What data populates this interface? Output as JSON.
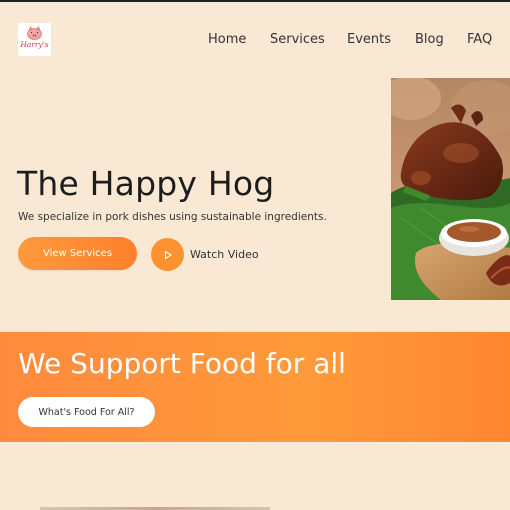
{
  "brand": {
    "logo_text": "Harry's",
    "logo_icon": "pig-icon"
  },
  "nav": {
    "items": [
      "Home",
      "Services",
      "Events",
      "Blog",
      "FAQ"
    ]
  },
  "hero": {
    "title": "The Happy Hog",
    "subtitle": "We specialize in pork dishes using sustainable ingredients.",
    "primary_button": "View Services",
    "video_label": "Watch Video",
    "play_icon": "play-icon"
  },
  "banner": {
    "title": "We Support Food for all",
    "button": "What's Food For All?"
  },
  "colors": {
    "background": "#f9e9d4",
    "accent": "#ff8a3d",
    "button_text": "#ffffff"
  }
}
